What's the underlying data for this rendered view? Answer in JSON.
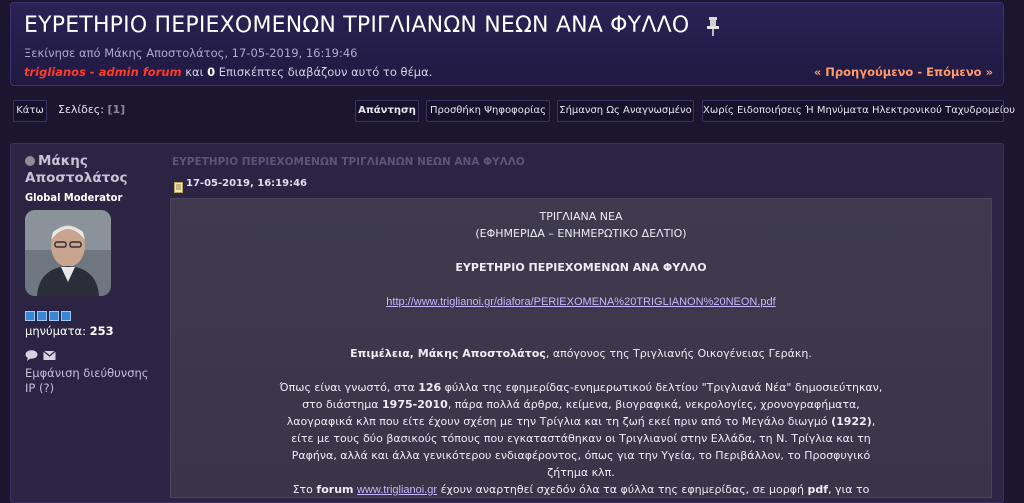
{
  "topic": {
    "title": "ΕΥΡΕΤΗΡΙΟ ΠΕΡΙΕΧΟΜΕΝΩΝ ΤΡΙΓΛΙΑΝΩΝ ΝΕΩΝ ΑΝΑ ΦΥΛΛΟ",
    "started_by": "Ξεκίνησε από Μάκης Αποστολάτος, 17-05-2019, 16:19:46",
    "viewers_user": "triglianos - admin forum",
    "viewers_and": " και ",
    "viewers_count": "0",
    "viewers_rest": " Επισκέπτες διαβάζουν αυτό το θέμα.",
    "prev_next": "« Προηγούμενο - Επόμενο »"
  },
  "toolbar": {
    "down": "Κάτω",
    "pages_label": "Σελίδες:",
    "pages_current": "[1]",
    "reply": "Απάντηση",
    "add_poll": "Προσθήκη Ψηφοφορίας",
    "mark_read": "Σήμανση Ως Αναγνωσμένο",
    "no_notify": "Χωρίς Ειδοποιήσεις Ή Μηνύματα Ηλεκτρονικού Ταχυδρομείου"
  },
  "poster": {
    "name_line1": "Μάκης",
    "name_line2": "Αποστολάτος",
    "role": "Global Moderator",
    "posts_label": "μηνύματα:",
    "posts_count": "253",
    "ip_line1": "Εμφάνιση διεύθυνσης",
    "ip_line2": "IP (?)"
  },
  "post": {
    "subject": "ΕΥΡΕΤΗΡΙΟ ΠΕΡΙΕΧΟΜΕΝΩΝ ΤΡΙΓΛΙΑΝΩΝ ΝΕΩΝ ΑΝΑ ΦΥΛΛΟ",
    "date": "17-05-2019, 16:19:46",
    "body": {
      "line1": "ΤΡΙΓΛΙΑΝΑ ΝΕΑ",
      "line2": "(ΕΦΗΜΕΡΙΔΑ – ΕΝΗΜΕΡΩΤΙΚΟ ΔΕΛΤΙΟ)",
      "heading": "ΕΥΡΕΤΗΡΙΟ ΠΕΡΙΕΧΟΜΕΝΩΝ ΑΝΑ ΦΥΛΛΟ",
      "url": "http://www.triglianoi.gr/diafora/PERIEXOMENA%20TRIGLIANON%20NEON.pdf",
      "editor_bold": "Επιμέλεια, Μάκης Αποστολάτος",
      "editor_rest": ", απόγονος της Τριγλιανής Οικογένειας Γεράκη.",
      "p1_a": "Όπως είναι γνωστό, στα ",
      "p1_b": "126",
      "p1_c": " φύλλα της εφημερίδας-ενημερωτικού δελτίου \"Τριγλιανά Νέα\" δημοσιεύτηκαν,",
      "p2_a": "στο διάστημα ",
      "p2_b": "1975-2010",
      "p2_c": ", πάρα πολλά άρθρα, κείμενα, βιογραφικά, νεκρολογίες, χρονογραφήματα,",
      "p3_a": "λαογραφικά κλπ που είτε έχουν σχέση με την Τρίγλια και τη ζωή εκεί πριν από το Μεγάλο διωγμό ",
      "p3_b": "(1922)",
      "p3_c": ",",
      "p4": "είτε με τους δύο βασικούς τόπους που εγκαταστάθηκαν οι Τριγλιανοί στην Ελλάδα, τη Ν. Τρίγλια και τη",
      "p5": "Ραφήνα, αλλά και άλλα γενικότερου ενδιαφέροντος, όπως για την Υγεία, το Περιβάλλον, το Προσφυγικό",
      "p6": "ζήτημα κλπ.",
      "p7_a": "Στο ",
      "p7_b": "forum",
      "p7_c": " ",
      "p7_link": "www.triglianoi.gr",
      "p7_d": " έχουν αναρτηθεί σχεδόν όλα τα φύλλα της εφημερίδας, σε μορφή ",
      "p7_e": "pdf",
      "p7_f": ", για το"
    }
  }
}
